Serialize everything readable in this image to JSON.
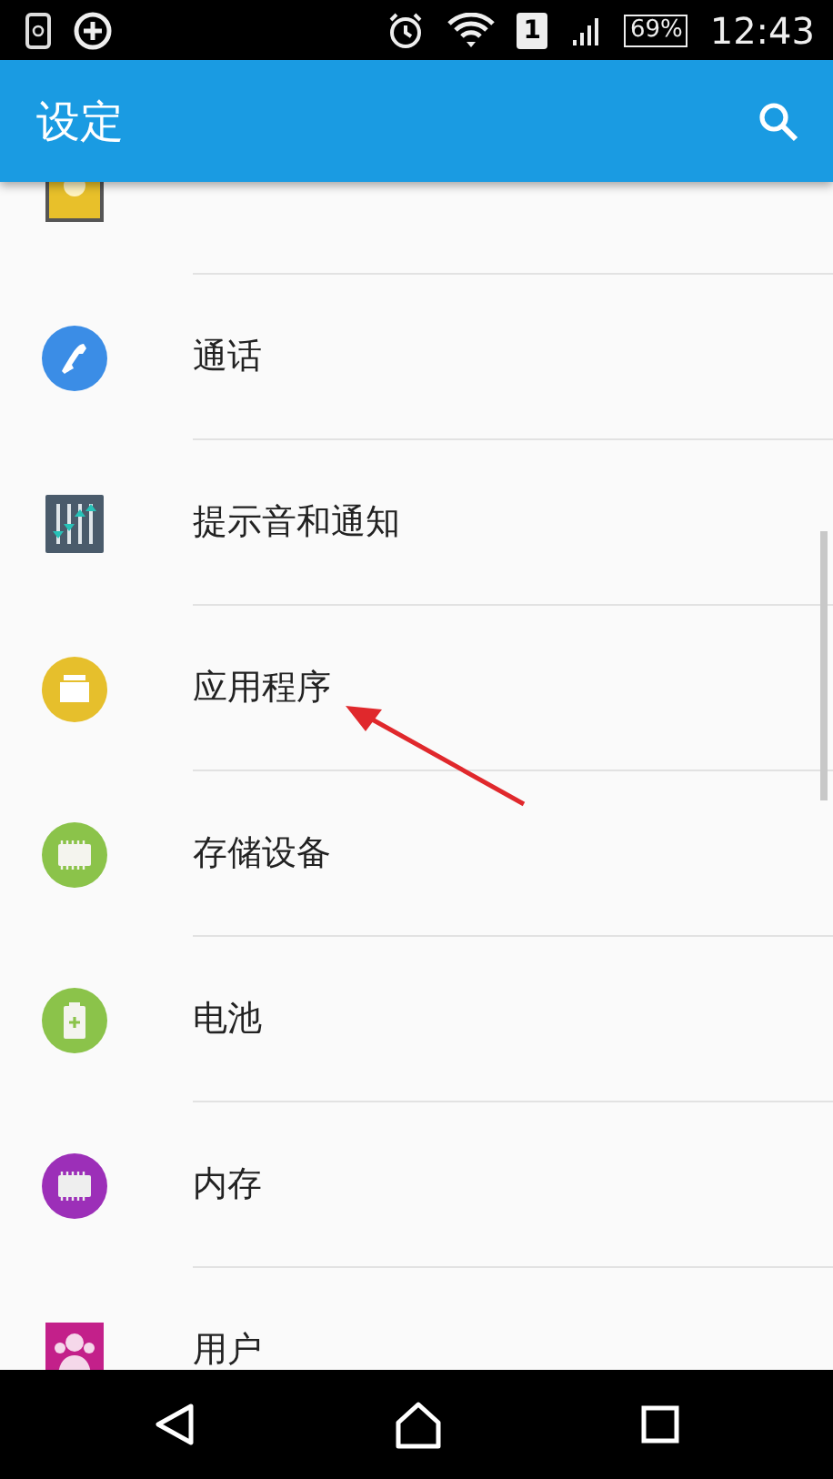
{
  "status_bar": {
    "sim_slot": "1",
    "battery": "69%",
    "time": "12:43"
  },
  "app_bar": {
    "title": "设定"
  },
  "items": [
    {
      "kind": "display"
    },
    {
      "kind": "call",
      "label": "通话"
    },
    {
      "kind": "sound",
      "label": "提示音和通知"
    },
    {
      "kind": "apps",
      "label": "应用程序"
    },
    {
      "kind": "storage",
      "label": "存储设备"
    },
    {
      "kind": "battery",
      "label": "电池"
    },
    {
      "kind": "memory",
      "label": "内存"
    },
    {
      "kind": "users",
      "label": "用户"
    }
  ]
}
